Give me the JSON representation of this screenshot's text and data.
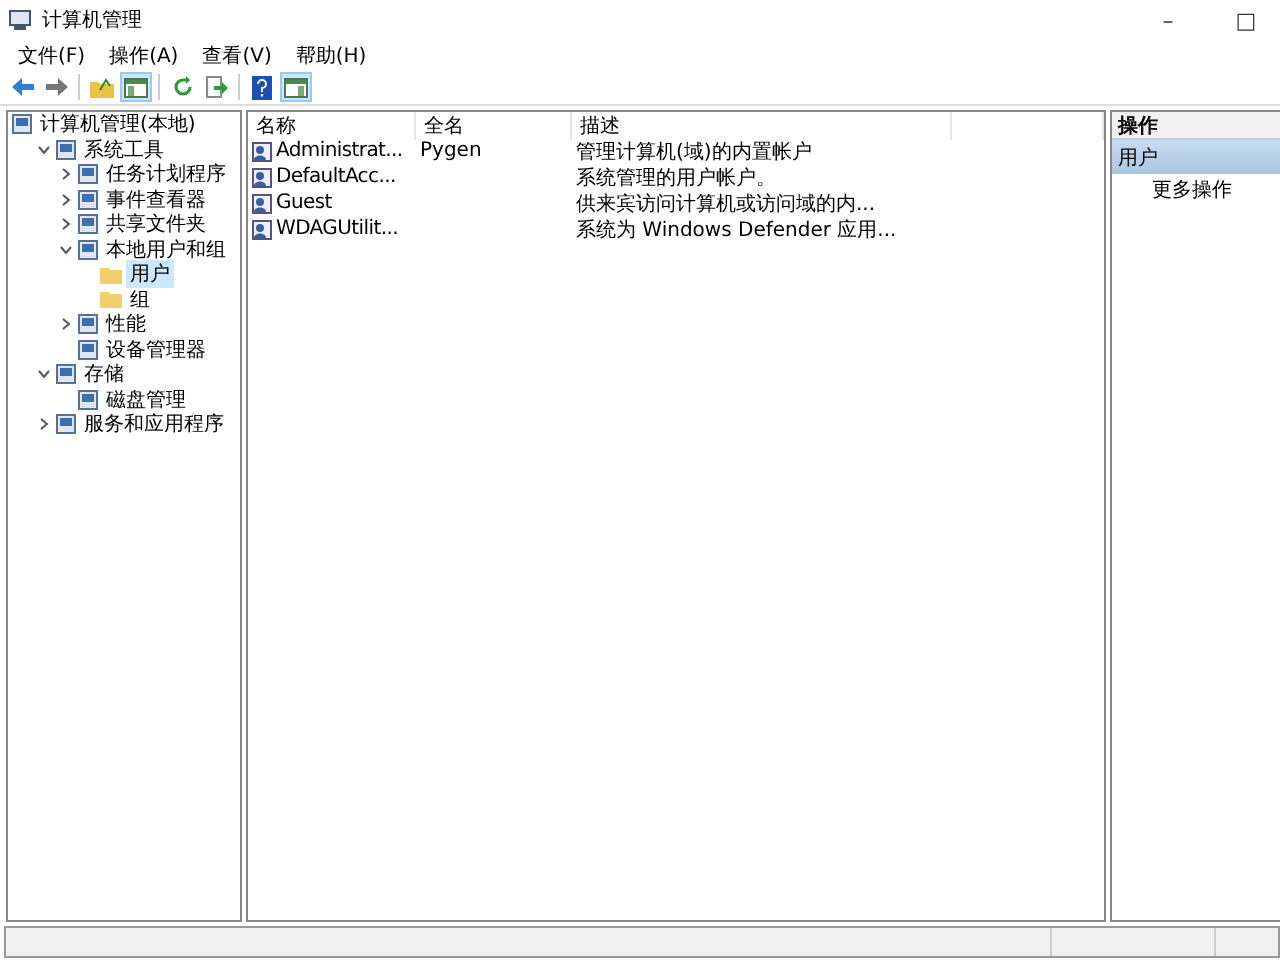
{
  "window": {
    "title": "计算机管理",
    "controls": [
      "–",
      "□"
    ]
  },
  "menu": [
    "文件(F)",
    "操作(A)",
    "查看(V)",
    "帮助(H)"
  ],
  "toolbar": [
    {
      "kind": "back",
      "pressed": false
    },
    {
      "kind": "forward",
      "pressed": false
    },
    {
      "kind": "sep"
    },
    {
      "kind": "up",
      "pressed": false
    },
    {
      "kind": "tree",
      "pressed": true
    },
    {
      "kind": "sep"
    },
    {
      "kind": "refresh",
      "pressed": false
    },
    {
      "kind": "export",
      "pressed": false
    },
    {
      "kind": "sep"
    },
    {
      "kind": "help",
      "pressed": false
    },
    {
      "kind": "pane",
      "pressed": true
    }
  ],
  "tree": [
    {
      "label": "计算机管理(本地)",
      "selected": false,
      "children": [
        {
          "label": "系统工具",
          "selected": false,
          "expanded": true,
          "children": [
            {
              "label": "任务计划程序",
              "selected": false,
              "expanded": false
            },
            {
              "label": "事件查看器",
              "selected": false,
              "expanded": false
            },
            {
              "label": "共享文件夹",
              "selected": false,
              "expanded": false
            },
            {
              "label": "本地用户和组",
              "selected": false,
              "expanded": true,
              "children": [
                {
                  "label": "用户",
                  "selected": true,
                  "kind": "folder"
                },
                {
                  "label": "组",
                  "selected": false,
                  "kind": "folder"
                }
              ]
            },
            {
              "label": "性能",
              "selected": false,
              "expanded": false
            },
            {
              "label": "设备管理器",
              "selected": false
            }
          ]
        },
        {
          "label": "存储",
          "selected": false,
          "expanded": true,
          "children": [
            {
              "label": "磁盘管理",
              "selected": false
            }
          ]
        },
        {
          "label": "服务和应用程序",
          "selected": false,
          "expanded": false
        }
      ]
    }
  ],
  "table": {
    "columns": [
      "名称",
      "全名",
      "描述"
    ],
    "rows": [
      {
        "name": "Administrat...",
        "full_name": "Pygen",
        "description": "管理计算机(域)的内置帐户"
      },
      {
        "name": "DefaultAcc...",
        "full_name": "",
        "description": "系统管理的用户帐户。"
      },
      {
        "name": "Guest",
        "full_name": "",
        "description": "供来宾访问计算机或访问域的内..."
      },
      {
        "name": "WDAGUtilit...",
        "full_name": "",
        "description": "系统为 Windows Defender 应用..."
      }
    ]
  },
  "actions": {
    "title": "操作",
    "section": "用户",
    "items": [
      "更多操作"
    ]
  }
}
